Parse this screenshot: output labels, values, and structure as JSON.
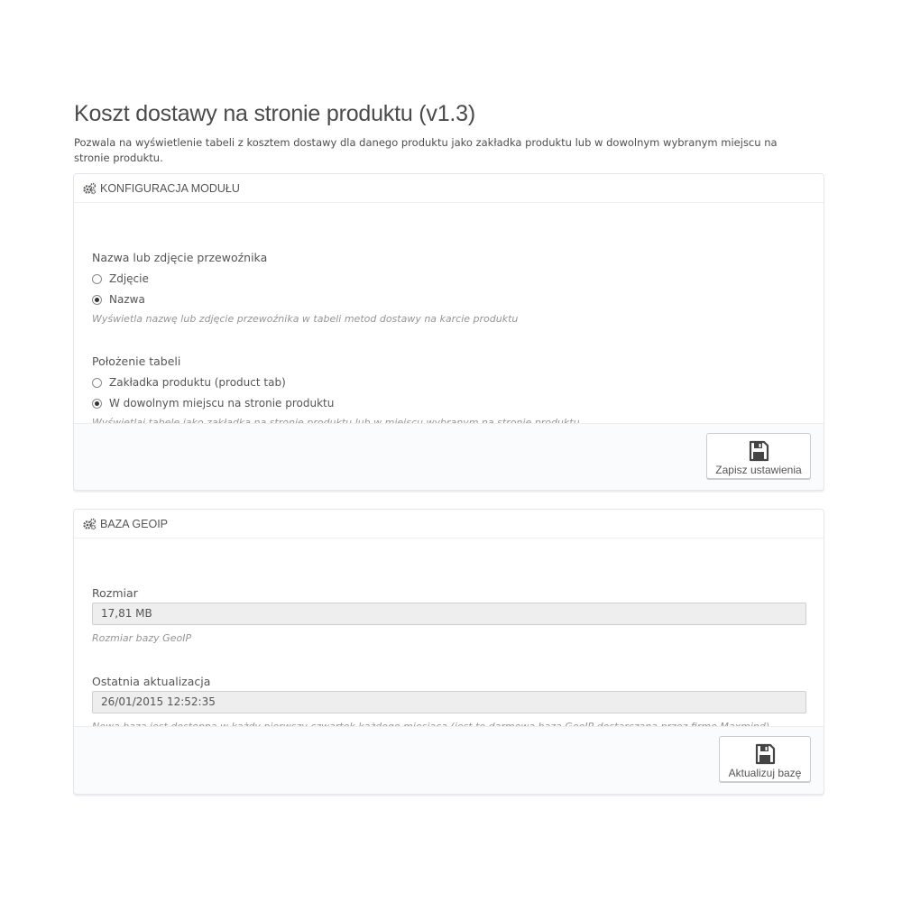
{
  "page": {
    "title": "Koszt dostawy na stronie produktu (v1.3)",
    "description": "Pozwala na wyświetlenie tabeli z kosztem dostawy dla danego produktu jako zakładka produktu lub w dowolnym wybranym miejscu na stronie produktu."
  },
  "config_panel": {
    "heading": "KONFIGURACJA MODUŁU",
    "heading_icon": "cogs-icon",
    "carrier_display": {
      "label": "Nazwa lub zdjęcie przewoźnika",
      "options": [
        {
          "label": "Zdjęcie",
          "checked": false
        },
        {
          "label": "Nazwa",
          "checked": true
        }
      ],
      "help": "Wyświetla nazwę lub zdjęcie przewoźnika w tabeli metod dostawy na karcie produktu"
    },
    "table_position": {
      "label": "Położenie tabeli",
      "options": [
        {
          "label": "Zakładka produktu (product tab)",
          "checked": false
        },
        {
          "label": "W dowolnym miejscu na stronie produktu",
          "checked": true
        }
      ],
      "help": "Wyświetlaj tabele jako zakładka na stronie produktu lub w miejscu wybranym na stronie produktu"
    },
    "save_button": {
      "label": "Zapisz ustawienia",
      "icon": "save-icon"
    }
  },
  "geoip_panel": {
    "heading": "BAZA GEOIP",
    "heading_icon": "cogs-icon",
    "size": {
      "label": "Rozmiar",
      "value": "17,81 MB",
      "help": "Rozmiar bazy GeoIP"
    },
    "last_update": {
      "label": "Ostatnia aktualizacja",
      "value": "26/01/2015 12:52:35",
      "help": "Nowa baza jest dostępna w każdy pierwszy czwartek każdego miesiąca (jest to darmowa baza GeoIP dostarczana przez firmę Maxmind)"
    },
    "update_button": {
      "label": "Aktualizuj bazę",
      "icon": "save-icon"
    }
  }
}
